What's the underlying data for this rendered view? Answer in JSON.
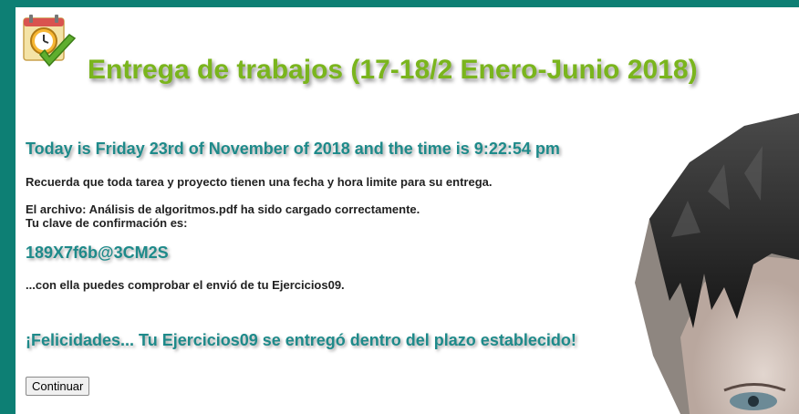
{
  "header": {
    "title": "Entrega de trabajos (17-18/2 Enero-Junio 2018)",
    "logo_icon": "calendar-clock-check-icon"
  },
  "main": {
    "datetime_line": "Today is Friday 23rd of November of 2018 and the time is 9:22:54 pm",
    "reminder": "Recuerda que toda tarea y proyecto tienen una fecha y hora limite para su entrega.",
    "upload_confirmation": "El archivo: Análisis de algoritmos.pdf ha sido cargado correctamente.",
    "confirmation_key_label": "Tu clave de confirmación es:",
    "confirmation_key": "189X7f6b@3CM2S",
    "verify_note": "...con ella puedes comprobar el envió de tu Ejercicios09.",
    "success_message": "¡Felicidades... Tu Ejercicios09 se entregó dentro del plazo establecido!",
    "continue_label": "Continuar"
  },
  "colors": {
    "frame": "#0d7f74",
    "title_green": "#7ab51d",
    "headline_teal": "#1e8a8a"
  }
}
